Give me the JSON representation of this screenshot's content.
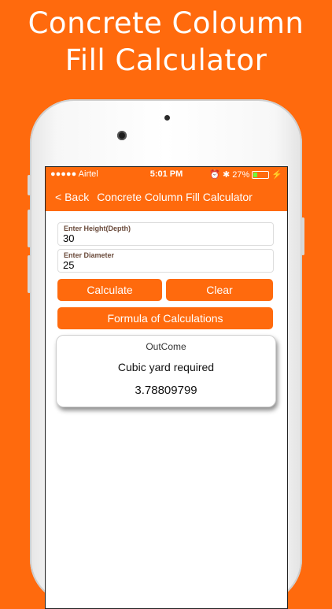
{
  "promo": {
    "title_line1": "Concrete Coloumn",
    "title_line2": "Fill Calculator"
  },
  "status_bar": {
    "carrier": "●●●●● Airtel",
    "time": "5:01 PM",
    "alarm_icon": "⏰",
    "bluetooth_icon": "✱",
    "battery_percent": "27%",
    "battery_level": 0.27,
    "charging_icon": "⚡"
  },
  "nav": {
    "back_label": "< Back",
    "title": "Concrete Column Fill Calculator"
  },
  "form": {
    "height_label": "Enter Height(Depth)",
    "height_value": "30",
    "diameter_label": "Enter Diameter",
    "diameter_value": "25"
  },
  "buttons": {
    "calculate": "Calculate",
    "clear": "Clear",
    "formula": "Formula of Calculations"
  },
  "result": {
    "title": "OutCome",
    "label": "Cubic yard required",
    "value": "3.78809799"
  },
  "colors": {
    "accent": "#FF6A0D",
    "battery_fill": "#6BFF3A"
  }
}
